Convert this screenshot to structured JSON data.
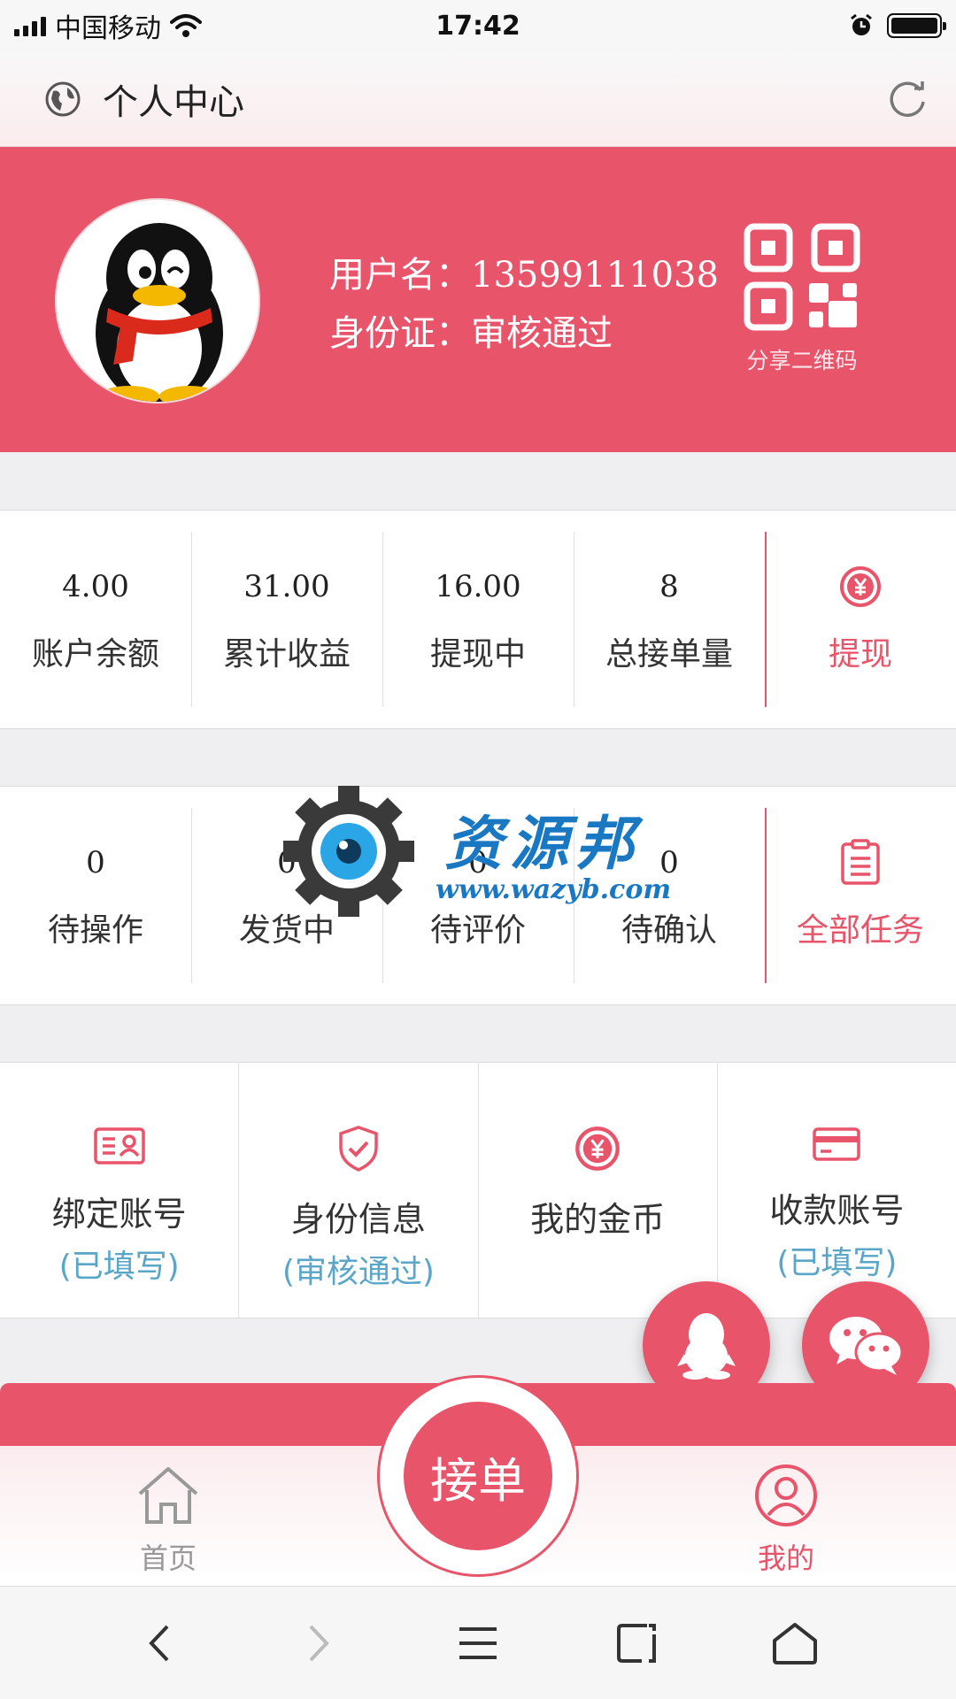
{
  "status_bar": {
    "carrier": "中国移动",
    "time": "17:42"
  },
  "header": {
    "title": "个人中心"
  },
  "profile": {
    "username_label": "用户名：",
    "username": "13599111038",
    "id_label": "身份证：",
    "id_status": "审核通过",
    "qr_label": "分享二维码"
  },
  "finance": {
    "items": [
      {
        "value": "4.00",
        "label": "账户余额"
      },
      {
        "value": "31.00",
        "label": "累计收益"
      },
      {
        "value": "16.00",
        "label": "提现中"
      },
      {
        "value": "8",
        "label": "总接单量"
      }
    ],
    "action_label": "提现"
  },
  "tasks": {
    "items": [
      {
        "value": "0",
        "label": "待操作"
      },
      {
        "value": "0",
        "label": "发货中"
      },
      {
        "value": "0",
        "label": "待评价"
      },
      {
        "value": "0",
        "label": "待确认"
      }
    ],
    "action_label": "全部任务"
  },
  "tools": [
    {
      "label": "绑定账号",
      "sub": "(已填写)",
      "icon": "id-card-icon"
    },
    {
      "label": "身份信息",
      "sub": "(审核通过)",
      "icon": "shield-check-icon"
    },
    {
      "label": "我的金币",
      "sub": "",
      "icon": "yen-coin-icon"
    },
    {
      "label": "收款账号",
      "sub": "(已填写)",
      "icon": "credit-card-icon"
    }
  ],
  "tabbar": {
    "home": "首页",
    "center": "接单",
    "mine": "我的"
  },
  "watermark": {
    "text": "资源邦",
    "url": "www.wazyb.com"
  },
  "colors": {
    "accent": "#e8546a",
    "sub_text": "#5aa6c8"
  }
}
